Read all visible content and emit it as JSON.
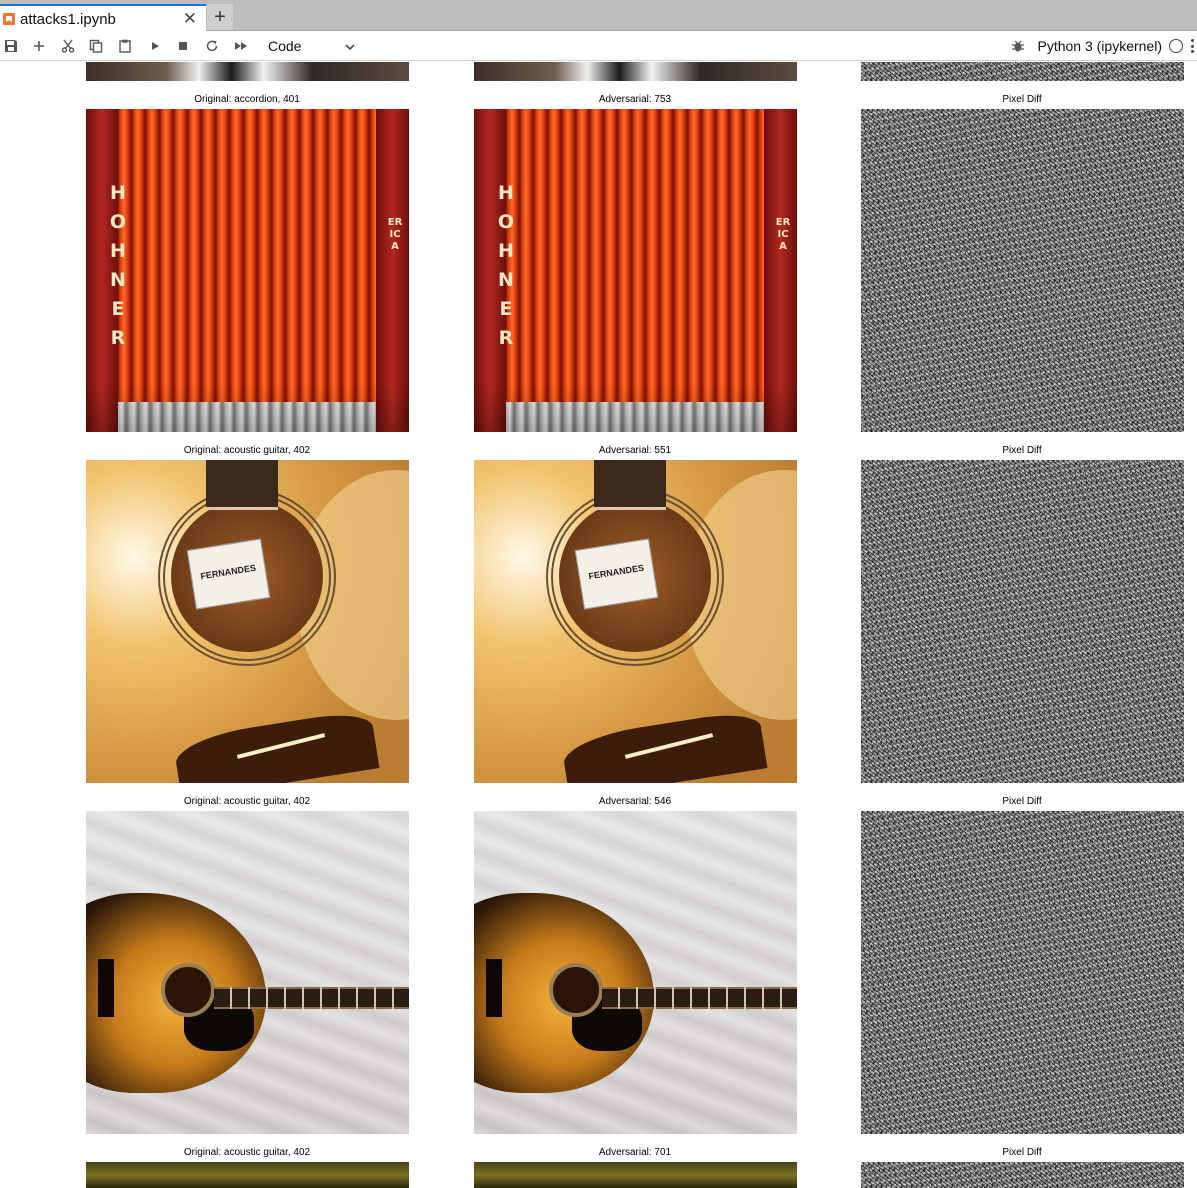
{
  "tab": {
    "title": "attacks1.ipynb",
    "close_glyph": "✕",
    "add_glyph": "+"
  },
  "toolbar": {
    "buttons": [
      {
        "name": "save-icon"
      },
      {
        "name": "add-cell-icon"
      },
      {
        "name": "cut-icon"
      },
      {
        "name": "copy-icon"
      },
      {
        "name": "paste-icon"
      },
      {
        "name": "run-icon"
      },
      {
        "name": "stop-icon"
      },
      {
        "name": "restart-icon"
      },
      {
        "name": "run-all-icon"
      }
    ],
    "cell_type": "Code",
    "kernel_name": "Python 3 (ipykernel)"
  },
  "output": {
    "rows": [
      {
        "original_label": "Original: accordion, 401",
        "adversarial_label": "Adversarial: 753",
        "diff_label": "Pixel Diff",
        "image": "accordion",
        "brand_text": "HOHNER",
        "brand_text_2": "ERICA"
      },
      {
        "original_label": "Original: acoustic guitar, 402",
        "adversarial_label": "Adversarial: 551",
        "diff_label": "Pixel Diff",
        "image": "guitar-closeup",
        "brand_text": "FERNANDES"
      },
      {
        "original_label": "Original: acoustic guitar, 402",
        "adversarial_label": "Adversarial: 546",
        "diff_label": "Pixel Diff",
        "image": "guitar-full"
      },
      {
        "original_label": "Original: acoustic guitar, 402",
        "adversarial_label": "Adversarial: 701",
        "diff_label": "Pixel Diff",
        "image": "partial"
      }
    ]
  },
  "colors": {
    "tab_accent": "#1976d2",
    "notebook_icon": "#f37626"
  }
}
